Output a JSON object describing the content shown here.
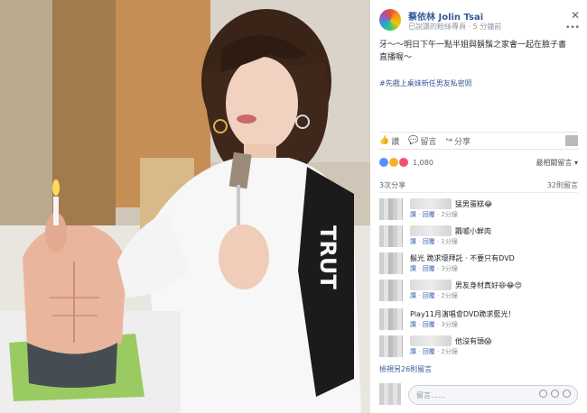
{
  "post": {
    "author": "蔡依林 Jolin Tsai",
    "meta": "已說讚的粉絲專頁 · 5 分鐘前",
    "text": "牙～～明日下午一點半姐與鬍鬚之家會一起在臉子書直播喔～",
    "hashtag": "#先戲上桌妹新任男友私密照"
  },
  "actions": {
    "like": "讚",
    "comment": "留言",
    "share": "分享"
  },
  "reactions": {
    "count": "1,080",
    "sort": "最相關留言"
  },
  "share_row": {
    "shares": "3次分享",
    "comments": "32則留言"
  },
  "comments": [
    {
      "text": "猛男蛋糕😂",
      "meta": [
        "讚",
        "回覆",
        "2分鐘"
      ]
    },
    {
      "text": "飄噓小鮮肉",
      "meta": [
        "讚",
        "回覆",
        "1分鐘"
      ]
    },
    {
      "text": "鬍光 跪求壞拜託 · 不要只有DVD",
      "meta": [
        "讚",
        "回覆",
        "3分鐘"
      ]
    },
    {
      "text": "男友身材真好😆😂😍",
      "meta": [
        "讚",
        "回覆",
        "2分鐘"
      ]
    },
    {
      "text": "Play11月演唱會DVD跪求藍光！",
      "meta": [
        "讚",
        "回覆",
        "3分鐘"
      ]
    },
    {
      "text": "他沒有頭😱",
      "meta": [
        "讚",
        "回覆",
        "2分鐘"
      ]
    }
  ],
  "more_comments": "檢視另26則留言",
  "reply": {
    "placeholder": "留言……"
  }
}
